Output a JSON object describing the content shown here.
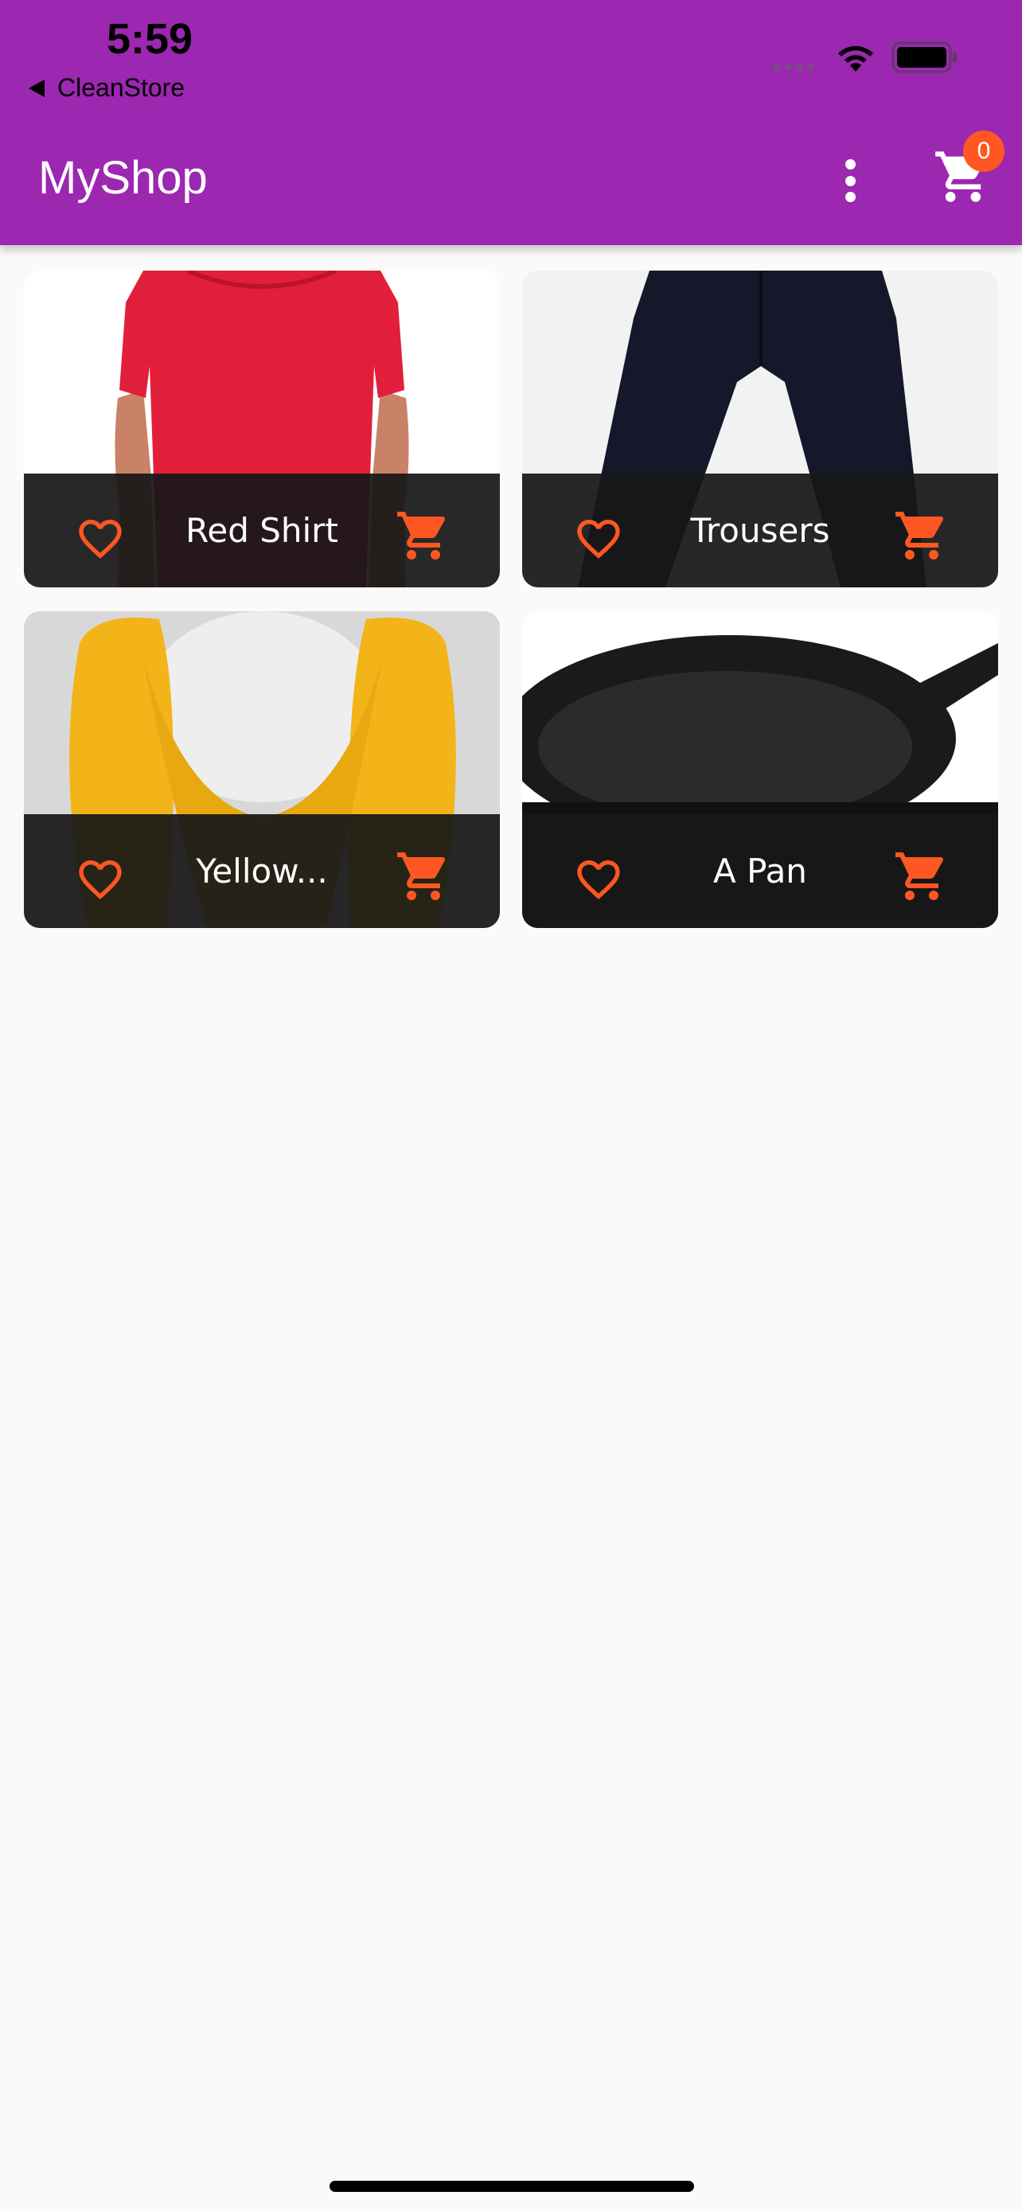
{
  "status_bar": {
    "time": "5:59",
    "back_app": "CleanStore",
    "icons": [
      "signal-dots-icon",
      "wifi-icon",
      "battery-icon"
    ]
  },
  "app_bar": {
    "title": "MyShop",
    "cart_count": "0",
    "icons": [
      "more-vert-icon",
      "shopping-cart-icon"
    ],
    "background_color": "#9c27b0",
    "badge_color": "#ff5722"
  },
  "products": [
    {
      "name": "Red Shirt",
      "image": "red-tshirt-photo"
    },
    {
      "name": "Trousers",
      "image": "dark-trousers-photo"
    },
    {
      "name": "Yellow...",
      "image": "yellow-scarf-photo"
    },
    {
      "name": "A Pan",
      "image": "cast-iron-pan-photo"
    }
  ],
  "colors": {
    "accent": "#ff5722",
    "tile_bar": "#181818",
    "background": "#fafafa"
  }
}
